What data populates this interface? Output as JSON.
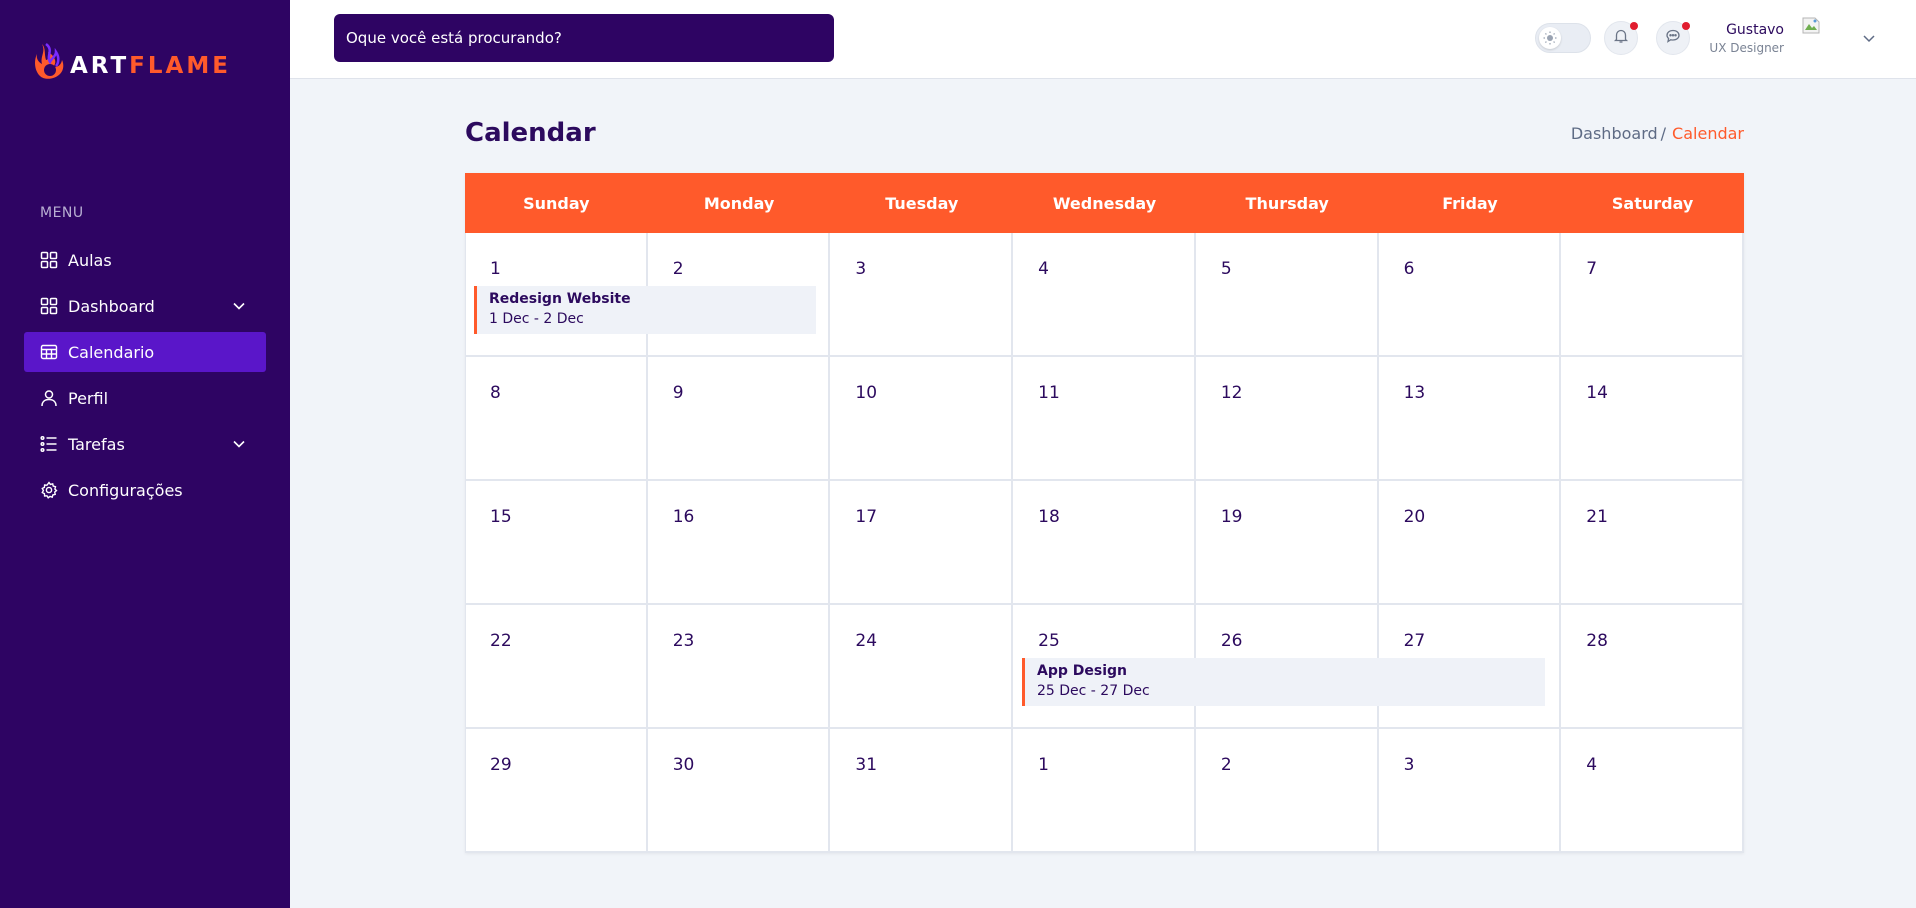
{
  "brand": {
    "part1": "ART",
    "part2": "FLAME",
    "accent": "#ff5a2b",
    "sidebar_bg": "#2e0463"
  },
  "sidebar": {
    "menu_title": "MENU",
    "items": [
      {
        "label": "Aulas",
        "icon": "grid-icon"
      },
      {
        "label": "Dashboard",
        "icon": "grid-icon",
        "expandable": true
      },
      {
        "label": "Calendario",
        "icon": "calendar-icon",
        "active": true
      },
      {
        "label": "Perfil",
        "icon": "user-icon"
      },
      {
        "label": "Tarefas",
        "icon": "list-icon",
        "expandable": true
      },
      {
        "label": "Configurações",
        "icon": "gear-icon"
      }
    ]
  },
  "header": {
    "search_placeholder": "Oque você está procurando?",
    "notifications_icon": "bell-icon",
    "messages_icon": "chat-icon",
    "user": {
      "name": "Gustavo",
      "role": "UX Designer"
    }
  },
  "page": {
    "title": "Calendar",
    "breadcrumb": {
      "parent": "Dashboard",
      "separator": "/",
      "current": "Calendar"
    }
  },
  "calendar": {
    "weekdays": [
      "Sunday",
      "Monday",
      "Tuesday",
      "Wednesday",
      "Thursday",
      "Friday",
      "Saturday"
    ],
    "days": [
      "1",
      "2",
      "3",
      "4",
      "5",
      "6",
      "7",
      "8",
      "9",
      "10",
      "11",
      "12",
      "13",
      "14",
      "15",
      "16",
      "17",
      "18",
      "19",
      "20",
      "21",
      "22",
      "23",
      "24",
      "25",
      "26",
      "27",
      "28",
      "29",
      "30",
      "31",
      "1",
      "2",
      "3",
      "4"
    ],
    "events": [
      {
        "title": "Redesign Website",
        "range": "1 Dec - 2 Dec"
      },
      {
        "title": "App Design",
        "range": "25 Dec - 27 Dec"
      }
    ]
  }
}
